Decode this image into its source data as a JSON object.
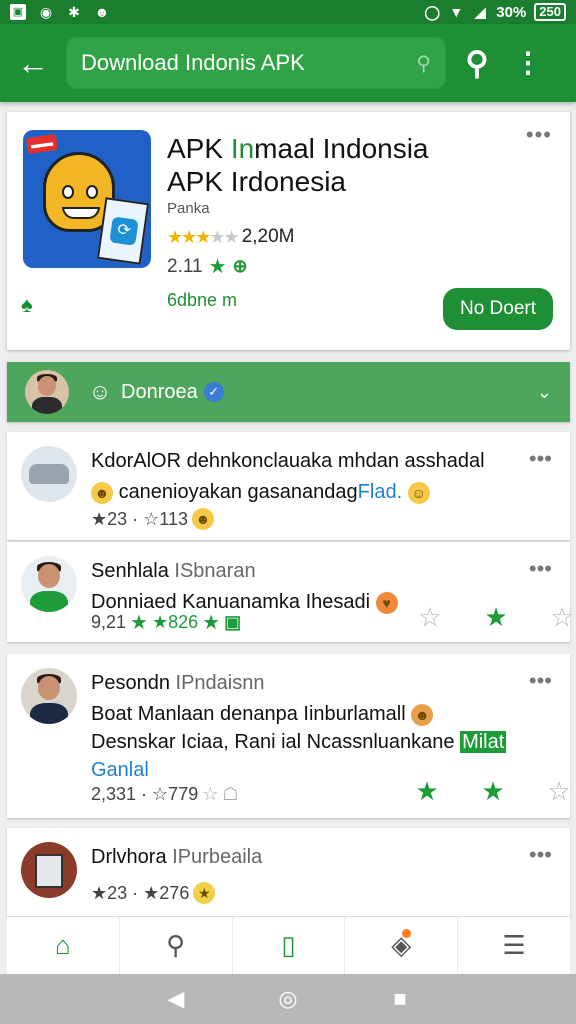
{
  "status_bar": {
    "battery_percent": "30%",
    "battery_label": "250",
    "left_icons": [
      "image-icon",
      "camera-icon",
      "puzzle-icon",
      "smile-icon"
    ],
    "right_icons": [
      "circle-icon",
      "wifi-icon",
      "signal-icon",
      "battery-icon"
    ]
  },
  "toolbar": {
    "search_value": "Download Indonis APK",
    "colors": {
      "bar": "#1f8f36",
      "status": "#1b7e2e"
    }
  },
  "app": {
    "title_part1": "APK ",
    "title_accent": "In",
    "title_part2": "maal Indonsia",
    "title_line2": "APK Irdonesia",
    "developer": "Panka",
    "rating_count": "2,20M",
    "stars_text": "★★★",
    "stars_off_text": "★★",
    "version": "2.11",
    "installs": "6dbne m",
    "download_label": "No Doert"
  },
  "dev_bar": {
    "name": "Donroea",
    "color": "#4ea55e"
  },
  "reviews": [
    {
      "name": "KdorAlOR",
      "handle": "",
      "text": "dehnkonclauaka mhdan asshadal",
      "text2": "canenioyakan gasanandag",
      "link": "Flad.",
      "meta": "★23 · ☆113"
    },
    {
      "name": "Senhlala",
      "handle": "ISbnaran",
      "text": "Donniaed Kanuanamka Ihesadi",
      "meta_num": "9,21",
      "meta_star": "★826"
    },
    {
      "name": "Pesondn",
      "handle": "IPndaisnn",
      "text": "Boat Manlaan denanpa Iinburlamall",
      "text2": "Desnskar Iciaa, Rani ial Ncassnluankane",
      "highlight": "Milat",
      "link": "Ganlal",
      "meta": "2,331 · ☆779"
    },
    {
      "name": "Drlvhora",
      "handle": "IPurbeaila",
      "meta": "★23 · ★276"
    }
  ],
  "bottom_nav": [
    "home-icon",
    "search-icon",
    "apps-icon",
    "notifications-icon",
    "menu-icon"
  ],
  "system_nav": {
    "back": "◀",
    "home": "◎",
    "recents": "■"
  }
}
